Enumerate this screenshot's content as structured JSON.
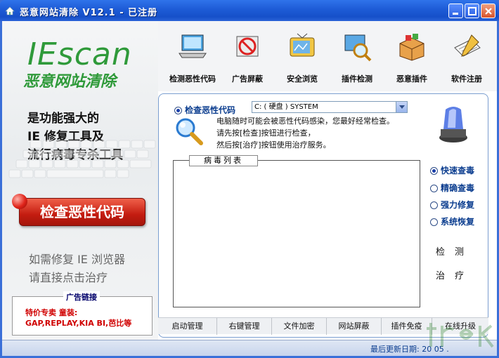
{
  "window": {
    "title": "恶意网站清除  V12.1 - 已注册"
  },
  "left": {
    "logo": "IEscan",
    "logo_sub": "恶意网站清除",
    "slogans": [
      "是功能强大的",
      "IE 修复工具及",
      "流行病毒专杀工具"
    ],
    "check_button": "检查恶性代码",
    "notes": [
      "如需修复 IE 浏览器",
      "请直接点击治疗"
    ],
    "ad": {
      "title": "广告链接",
      "lines": [
        "特价专卖  童装:",
        "GAP,REPLAY,KIA BI,芭比等"
      ]
    }
  },
  "toolbar": {
    "items": [
      {
        "label": "检测恶性代码",
        "icon": "laptop-icon"
      },
      {
        "label": "广告屏蔽",
        "icon": "no-ads-icon"
      },
      {
        "label": "安全浏览",
        "icon": "tv-icon"
      },
      {
        "label": "插件检测",
        "icon": "magnifier-screen-icon"
      },
      {
        "label": "恶意插件",
        "icon": "box-icon"
      },
      {
        "label": "软件注册",
        "icon": "pen-paper-icon"
      }
    ]
  },
  "panel": {
    "check_option": "检查恶性代码",
    "drive_select": "C: ( 硬盘 ) SYSTEM",
    "info": [
      "电脑随时可能会被恶性代码感染，您最好经常检查。",
      "请先按[检查]按钮进行检查，",
      "然后按[治疗]按钮使用治疗服务。"
    ],
    "list_title": "病毒列表",
    "right_options": [
      "快速查毒",
      "精确查毒",
      "强力修复",
      "系统恢复"
    ],
    "detect_label": "检测",
    "treat_label": "治疗"
  },
  "bottom": {
    "buttons": [
      "启动管理",
      "右键管理",
      "文件加密",
      "网站屏蔽",
      "插件免疫",
      "在线升级"
    ]
  },
  "status": {
    "text": "最后更新日期: 20  05  ."
  },
  "colors": {
    "titlebar": "#1d5bd6",
    "logo_green": "#2f9a3a",
    "accent_red": "#c41c10",
    "link_blue": "#0b3d8f"
  }
}
